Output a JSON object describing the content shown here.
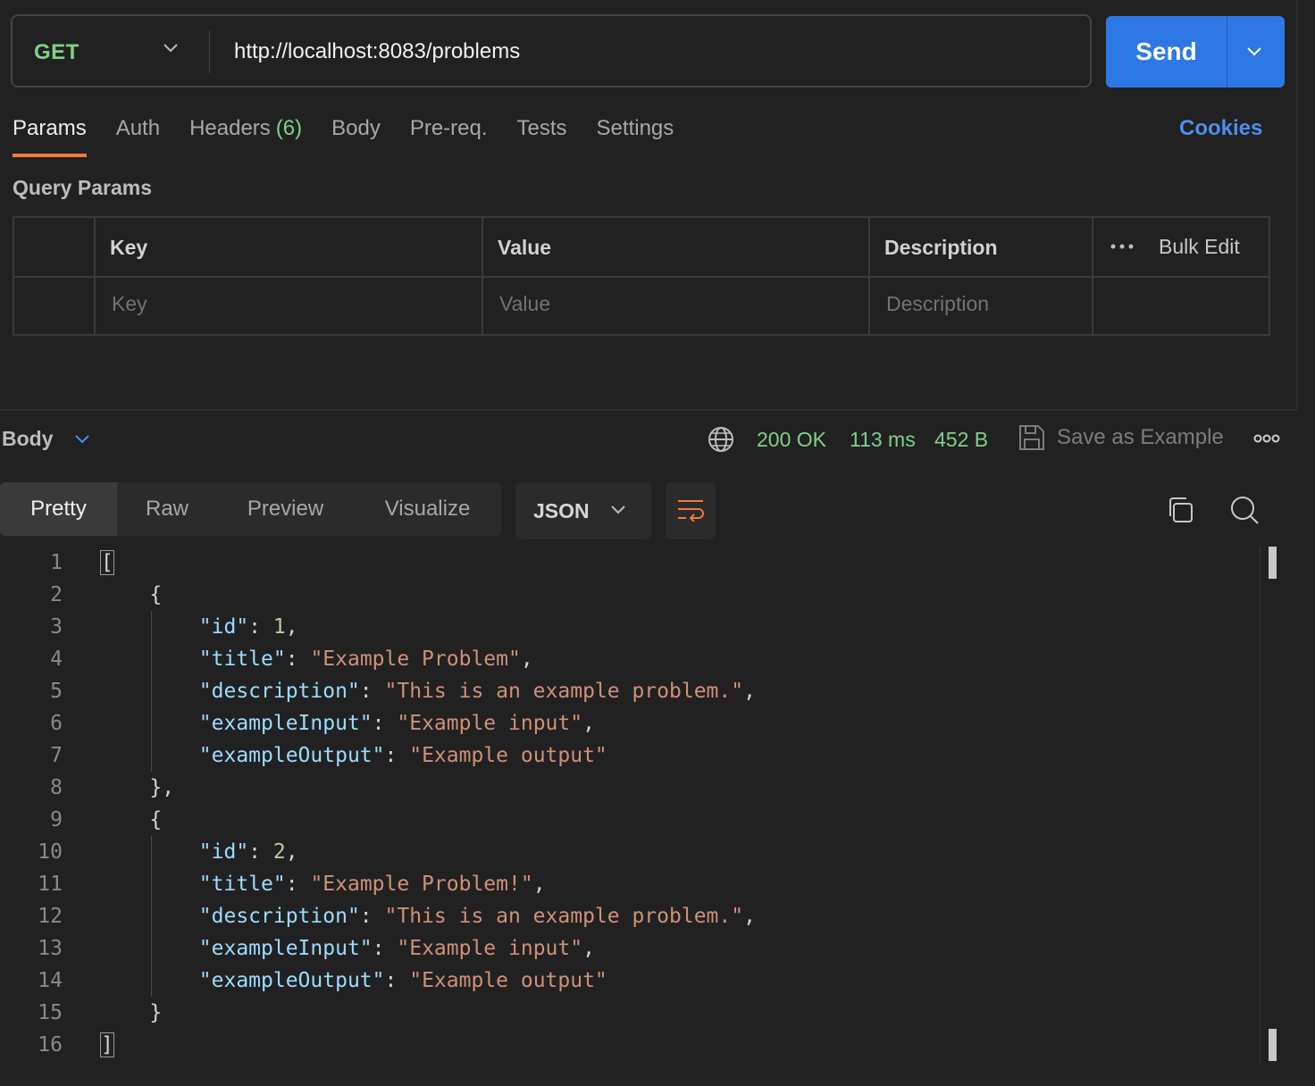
{
  "request": {
    "method": "GET",
    "url": "http://localhost:8083/problems",
    "send_label": "Send"
  },
  "tabs": [
    {
      "label": "Params",
      "active": true
    },
    {
      "label": "Auth"
    },
    {
      "label": "Headers",
      "count": "(6)"
    },
    {
      "label": "Body"
    },
    {
      "label": "Pre-req."
    },
    {
      "label": "Tests"
    },
    {
      "label": "Settings"
    }
  ],
  "cookies_label": "Cookies",
  "query_params": {
    "title": "Query Params",
    "headers": {
      "key": "Key",
      "value": "Value",
      "description": "Description"
    },
    "bulk_edit": "Bulk Edit",
    "placeholders": {
      "key": "Key",
      "value": "Value",
      "description": "Description"
    }
  },
  "response": {
    "title": "Body",
    "status": "200 OK",
    "time": "113 ms",
    "size": "452 B",
    "save_example": "Save as Example",
    "views": [
      "Pretty",
      "Raw",
      "Preview",
      "Visualize"
    ],
    "active_view": "Pretty",
    "format": "JSON"
  },
  "code_lines": [
    "[",
    "    {",
    "        \"id\": 1,",
    "        \"title\": \"Example Problem\",",
    "        \"description\": \"This is an example problem.\",",
    "        \"exampleInput\": \"Example input\",",
    "        \"exampleOutput\": \"Example output\"",
    "    },",
    "    {",
    "        \"id\": 2,",
    "        \"title\": \"Example Problem!\",",
    "        \"description\": \"This is an example problem.\",",
    "        \"exampleInput\": \"Example input\",",
    "        \"exampleOutput\": \"Example output\"",
    "    }",
    "]"
  ],
  "colors": {
    "accent": "#2e78e6",
    "success": "#7fd18b",
    "active_tab_underline": "#ef7a3d",
    "json_key": "#9cdcfe",
    "json_string": "#ce9178",
    "json_number": "#b5cea8"
  }
}
